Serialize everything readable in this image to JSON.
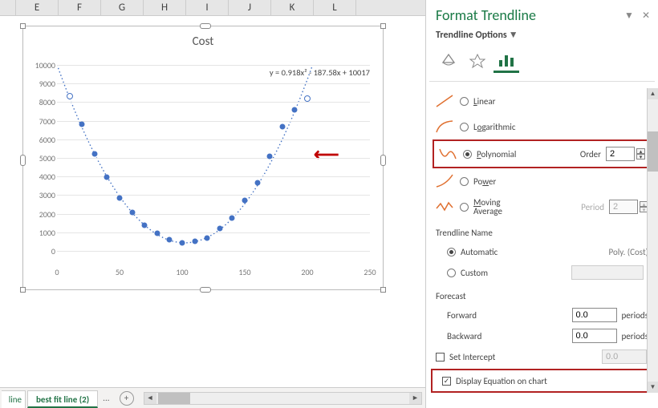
{
  "cols": [
    "E",
    "F",
    "G",
    "H",
    "I",
    "J",
    "K",
    "L"
  ],
  "chart_data": {
    "type": "scatter",
    "title": "Cost",
    "equation": "y = 0.918x² - 187.58x + 10017",
    "xlim": [
      0,
      250
    ],
    "ylim": [
      0,
      10000
    ],
    "xticks": [
      0,
      50,
      100,
      150,
      200,
      250
    ],
    "yticks": [
      0,
      1000,
      2000,
      3000,
      4000,
      5000,
      6000,
      7000,
      8000,
      9000,
      10000
    ],
    "trendline": {
      "type": "polynomial",
      "order": 2,
      "coeffs": [
        0.918,
        -187.58,
        10017
      ]
    },
    "x": [
      10,
      20,
      30,
      40,
      50,
      60,
      70,
      80,
      90,
      100,
      110,
      120,
      130,
      140,
      150,
      160,
      170,
      180,
      190,
      200
    ],
    "y": [
      8300,
      6800,
      5200,
      3950,
      2850,
      2050,
      1400,
      950,
      600,
      450,
      500,
      700,
      1200,
      1750,
      2700,
      3650,
      5100,
      6700,
      7600,
      8200
    ]
  },
  "sheet_tabs": {
    "partial": "line",
    "active": "best fit line (2)",
    "more": "..."
  },
  "panel": {
    "title": "Format Trendline",
    "subtitle": "Trendline Options",
    "opts": {
      "linear": "Linear",
      "log": "Logarithmic",
      "poly": "Polynomial",
      "power": "Power",
      "mavg": "Moving Average",
      "order_label": "Order",
      "order_val": "2",
      "period_label": "Period",
      "period_val": "2"
    },
    "name_section": "Trendline Name",
    "name_auto": "Automatic",
    "name_auto_val": "Poly. (Cost)",
    "name_custom": "Custom",
    "forecast": "Forecast",
    "forward": "Forward",
    "backward": "Backward",
    "periods": "periods",
    "fc_val": "0.0",
    "set_intercept": "Set Intercept",
    "intercept_val": "0.0",
    "display_eq": "Display Equation on chart"
  }
}
